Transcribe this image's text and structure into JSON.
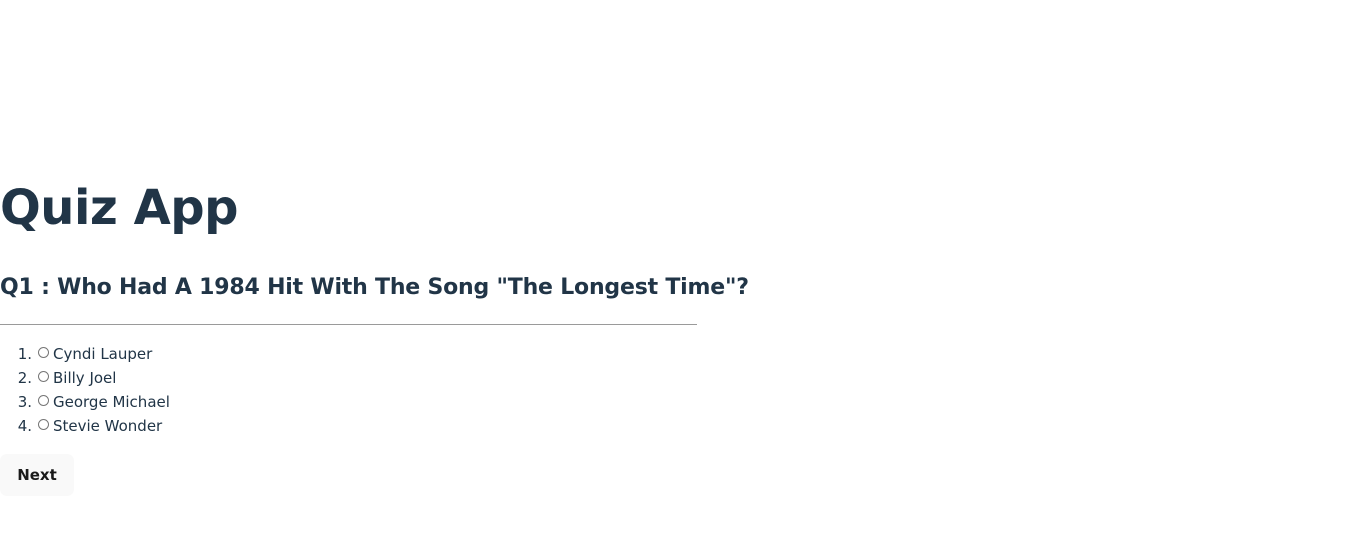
{
  "app": {
    "title": "Quiz App"
  },
  "question": {
    "text": "Q1 : Who Had A 1984 Hit With The Song \"The Longest Time\"?"
  },
  "options": [
    {
      "number": "1.",
      "label": "Cyndi Lauper",
      "selected": false
    },
    {
      "number": "2.",
      "label": "Billy Joel",
      "selected": false
    },
    {
      "number": "3.",
      "label": "George Michael",
      "selected": false
    },
    {
      "number": "4.",
      "label": "Stevie Wonder",
      "selected": false
    }
  ],
  "actions": {
    "next_label": "Next"
  },
  "colors": {
    "heading": "#213547",
    "button_bg": "#f9f9f9",
    "divider": "#9a9a9a"
  }
}
